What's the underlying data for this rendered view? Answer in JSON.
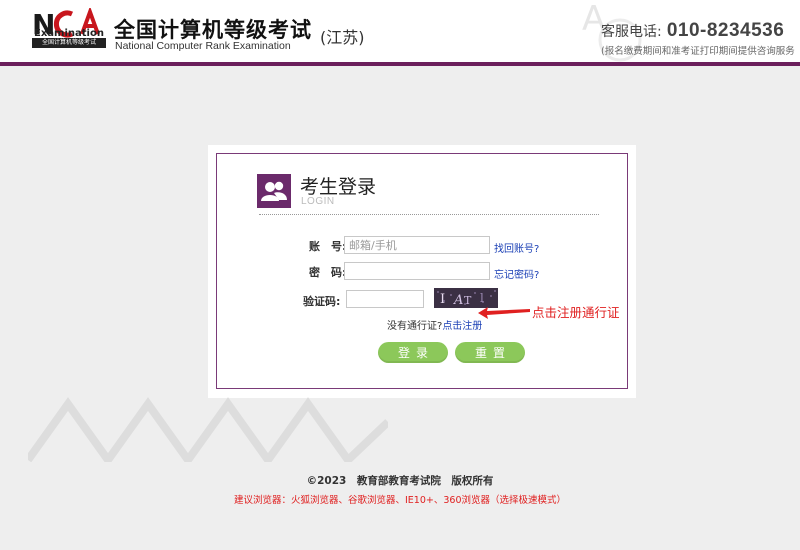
{
  "header": {
    "logo_text": "NCRE",
    "logo_sub": "全国计算机等级考试",
    "logo_eng": "Examination",
    "title_cn": "全国计算机等级考试",
    "title_en": "National Computer Rank Examination",
    "region": "(江苏)",
    "hotline_label": "客服电话:",
    "hotline_number": "010-8234536",
    "hotline_note": "(报名缴费期间和准考证打印期间提供咨询服务"
  },
  "login": {
    "title": "考生登录",
    "subtitle": "LOGIN",
    "icon": "users-icon",
    "account_label": "账　号:",
    "account_placeholder": "邮箱/手机",
    "account_value": "",
    "find_account_link": "找回账号?",
    "password_label": "密　码:",
    "password_value": "",
    "forgot_password_link": "忘记密码?",
    "captcha_label": "验证码:",
    "captcha_value": "",
    "captcha_icon": "captcha-image",
    "no_pass_text": "没有通行证?",
    "register_link": "点击注册",
    "login_button": "登录",
    "reset_button": "重置"
  },
  "annotation": {
    "text": "点击注册通行证",
    "color": "#e02020"
  },
  "footer": {
    "copyright": "©2023　教育部教育考试院　版权所有",
    "browser_tip": "建议浏览器：火狐浏览器、谷歌浏览器、IE10+、360浏览器（选择极速模式）"
  },
  "colors": {
    "accent": "#6b1f5c",
    "button": "#8cc85a",
    "link": "#1a3fb5",
    "warning": "#e02020"
  }
}
